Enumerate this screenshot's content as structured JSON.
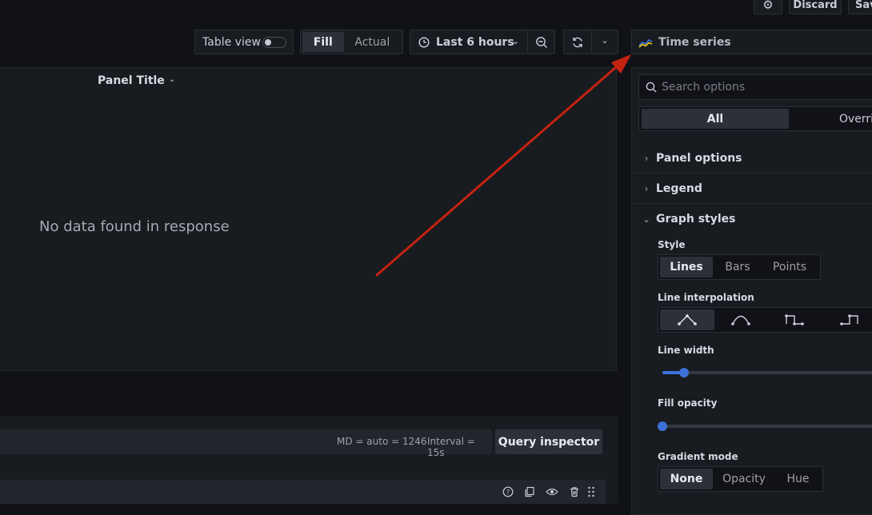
{
  "topbar": {
    "discard_label": "Discard",
    "save_label": "Sav"
  },
  "toolbar": {
    "table_view_label": "Table view",
    "table_view_on": false,
    "fill_label": "Fill",
    "actual_label": "Actual",
    "time_range_label": "Last 6 hours",
    "visualization_label": "Time series"
  },
  "panel": {
    "title": "Panel Title",
    "empty_message": "No data found in response"
  },
  "query_bar": {
    "md_text": "MD = auto = 1246",
    "interval_text": "Interval = 15s",
    "inspector_label": "Query inspector"
  },
  "options": {
    "search_placeholder": "Search options",
    "tabs": [
      {
        "label": "All",
        "active": true
      },
      {
        "label": "Overri",
        "active": false
      }
    ],
    "sections": [
      {
        "label": "Panel options",
        "expanded": false
      },
      {
        "label": "Legend",
        "expanded": false
      },
      {
        "label": "Graph styles",
        "expanded": true
      }
    ],
    "style": {
      "label": "Style",
      "options": [
        "Lines",
        "Bars",
        "Points"
      ],
      "selected": "Lines"
    },
    "line_interpolation": {
      "label": "Line interpolation",
      "options": [
        "linear-icon",
        "smooth-icon",
        "step-before-icon",
        "step-after-icon"
      ],
      "selected": "linear-icon"
    },
    "line_width": {
      "label": "Line width",
      "value_fraction": 0.1
    },
    "fill_opacity": {
      "label": "Fill opacity",
      "value_fraction": 0.0
    },
    "gradient_mode": {
      "label": "Gradient mode",
      "options": [
        "None",
        "Opacity",
        "Hue"
      ],
      "selected": "None"
    }
  },
  "colors": {
    "accent_blue": "#3d71d9",
    "annotation_arrow": "#c4230f"
  }
}
